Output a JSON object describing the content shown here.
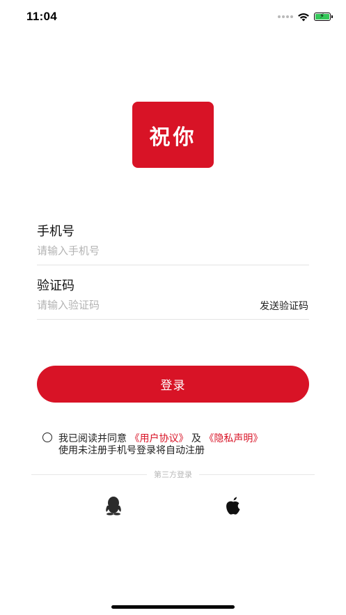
{
  "status_bar": {
    "time": "11:04"
  },
  "logo": {
    "text": "祝你"
  },
  "form": {
    "phone": {
      "label": "手机号",
      "placeholder": "请输入手机号",
      "value": ""
    },
    "code": {
      "label": "验证码",
      "placeholder": "请输入验证码",
      "value": "",
      "send_label": "发送验证码"
    },
    "login_label": "登录"
  },
  "agreement": {
    "prefix": "我已阅读并同意",
    "user_agreement": "《用户协议》",
    "conjunction": "及",
    "privacy": "《隐私声明》",
    "note": "使用未注册手机号登录将自动注册"
  },
  "third_party": {
    "title": "第三方登录",
    "icons": [
      "qq-icon",
      "apple-icon"
    ]
  },
  "colors": {
    "brand": "#d81326",
    "battery": "#34c759"
  }
}
